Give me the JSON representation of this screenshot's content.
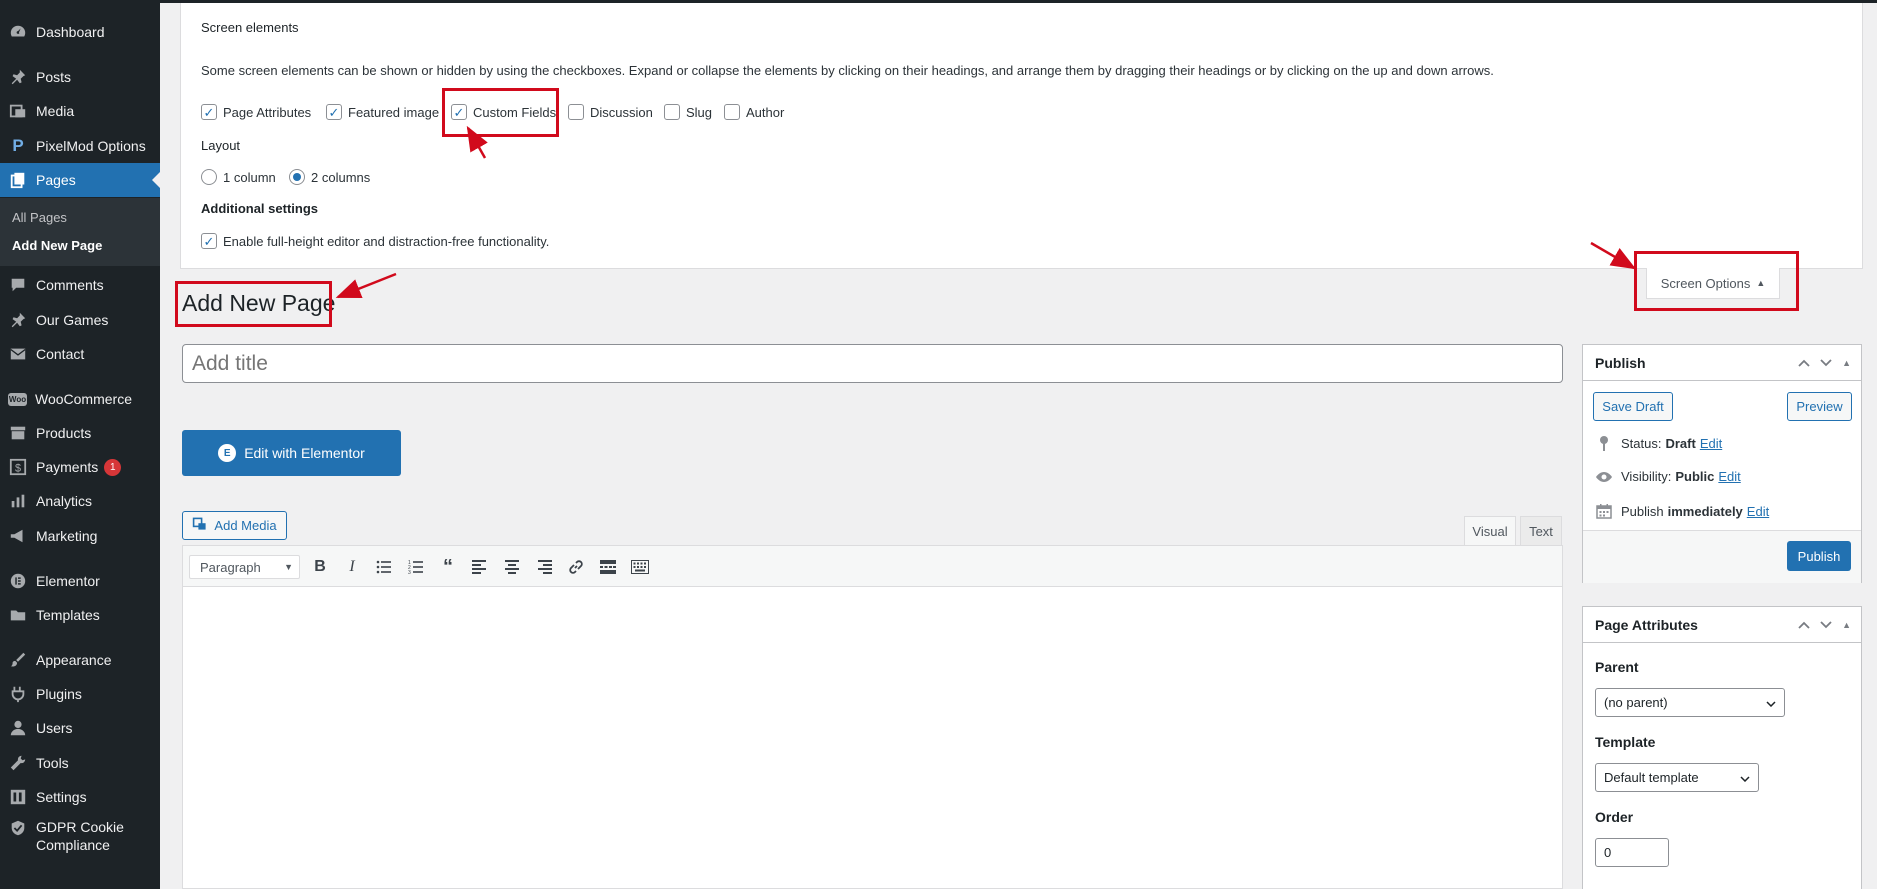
{
  "sidebar": {
    "items": [
      {
        "label": "Dashboard",
        "icon": "dashboard-icon"
      },
      {
        "label": "Posts",
        "icon": "pin-icon"
      },
      {
        "label": "Media",
        "icon": "media-icon"
      },
      {
        "label": "PixelMod Options",
        "icon": "p-logo-icon"
      },
      {
        "label": "Pages",
        "icon": "pages-icon"
      },
      {
        "label": "Comments",
        "icon": "comment-icon"
      },
      {
        "label": "Our Games",
        "icon": "pin-icon"
      },
      {
        "label": "Contact",
        "icon": "mail-icon"
      },
      {
        "label": "WooCommerce",
        "icon": "woo-icon"
      },
      {
        "label": "Products",
        "icon": "archive-icon"
      },
      {
        "label": "Payments",
        "icon": "dollar-icon",
        "badge": "1"
      },
      {
        "label": "Analytics",
        "icon": "bar-chart-icon"
      },
      {
        "label": "Marketing",
        "icon": "megaphone-icon"
      },
      {
        "label": "Elementor",
        "icon": "elementor-icon"
      },
      {
        "label": "Templates",
        "icon": "folder-icon"
      },
      {
        "label": "Appearance",
        "icon": "brush-icon"
      },
      {
        "label": "Plugins",
        "icon": "plug-icon"
      },
      {
        "label": "Users",
        "icon": "user-icon"
      },
      {
        "label": "Tools",
        "icon": "wrench-icon"
      },
      {
        "label": "Settings",
        "icon": "settings-icon"
      },
      {
        "label": "GDPR Cookie",
        "label2": "Compliance",
        "icon": "shield-icon"
      }
    ],
    "submenu": {
      "all_pages": "All Pages",
      "add_new": "Add New Page"
    }
  },
  "screen_options": {
    "heading": "Screen elements",
    "description": "Some screen elements can be shown or hidden by using the checkboxes. Expand or collapse the elements by clicking on their headings, and arrange them by dragging their headings or by clicking on the up and down arrows.",
    "elements": [
      {
        "label": "Page Attributes",
        "checked": true
      },
      {
        "label": "Featured image",
        "checked": true
      },
      {
        "label": "Custom Fields",
        "checked": true
      },
      {
        "label": "Discussion",
        "checked": false
      },
      {
        "label": "Slug",
        "checked": false
      },
      {
        "label": "Author",
        "checked": false
      }
    ],
    "layout_heading": "Layout",
    "layout_options": [
      {
        "label": "1 column",
        "selected": false
      },
      {
        "label": "2 columns",
        "selected": true
      }
    ],
    "additional_heading": "Additional settings",
    "fullheight_label": "Enable full-height editor and distraction-free functionality.",
    "fullheight_checked": true,
    "toggle_label": "Screen Options"
  },
  "page": {
    "title": "Add New Page",
    "title_placeholder": "Add title",
    "elementor_label": "Edit with Elementor",
    "add_media_label": "Add Media",
    "tabs": {
      "visual": "Visual",
      "text": "Text"
    },
    "format_value": "Paragraph"
  },
  "publish": {
    "heading": "Publish",
    "save_draft": "Save Draft",
    "preview": "Preview",
    "status_label": "Status:",
    "status_value": "Draft",
    "visibility_label": "Visibility:",
    "visibility_value": "Public",
    "publish_label": "Publish",
    "publish_value": "immediately",
    "edit": "Edit",
    "publish_button": "Publish"
  },
  "page_attributes": {
    "heading": "Page Attributes",
    "parent_label": "Parent",
    "parent_value": "(no parent)",
    "template_label": "Template",
    "template_value": "Default template",
    "order_label": "Order",
    "order_value": "0"
  },
  "colors": {
    "accent": "#2271b1",
    "sidebar": "#1d2327",
    "highlight": "#d10a1c"
  }
}
